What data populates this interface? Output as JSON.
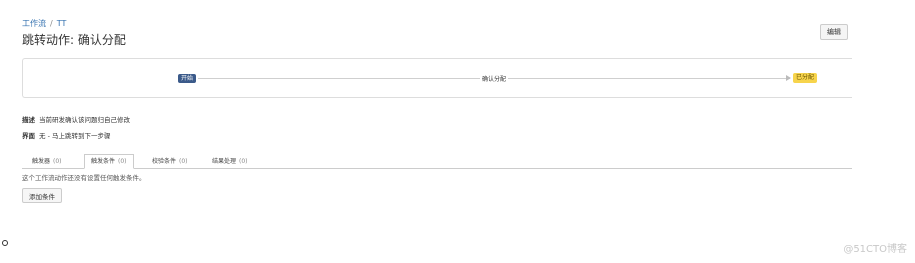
{
  "breadcrumb": {
    "parent": "工作流",
    "separator": "/",
    "current": "TT"
  },
  "page_title": "跳转动作: 确认分配",
  "edit_label": "编辑",
  "workflow": {
    "from_status": "开始",
    "action": "确认分配",
    "to_status": "已分配",
    "colors": {
      "from": "#3b5a8a",
      "to": "#f7d44c"
    }
  },
  "description": {
    "label": "描述",
    "value": "当前研发确认该问题归自己修改"
  },
  "screen": {
    "label": "界面",
    "value": "无 - 马上跳转到下一步骤"
  },
  "tabs": [
    {
      "label": "触发器",
      "count": "(0)"
    },
    {
      "label": "触发条件",
      "count": "(0)"
    },
    {
      "label": "校验条件",
      "count": "(0)"
    },
    {
      "label": "结果处理",
      "count": "(0)"
    }
  ],
  "empty_message": "这个工作流动作还没有设置任何触发条件。",
  "add_condition_label": "添加条件",
  "watermark": "@51CTO博客"
}
